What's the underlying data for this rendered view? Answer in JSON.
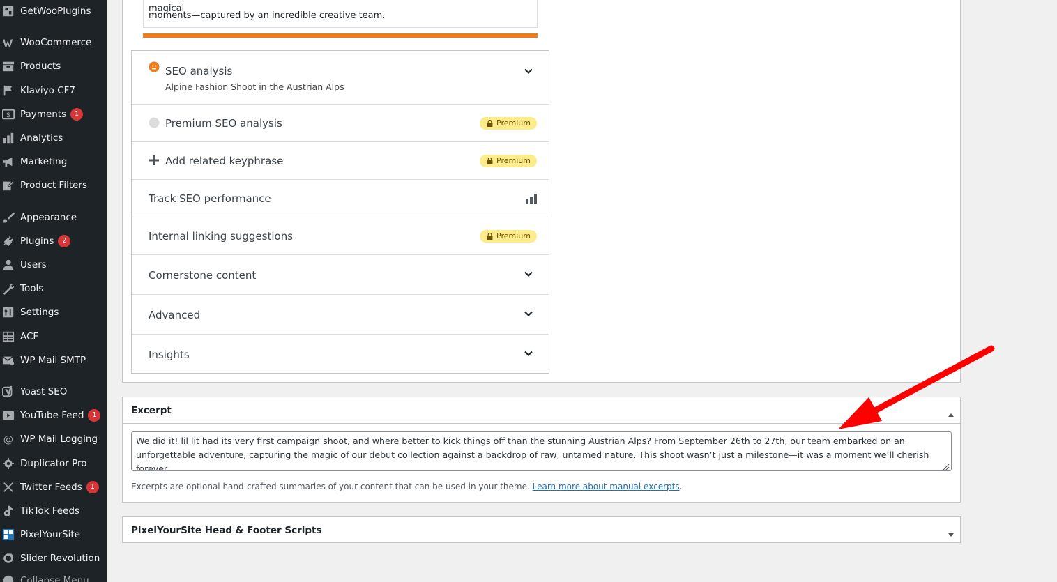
{
  "sidebar": {
    "items": [
      {
        "label": "GetWooPlugins",
        "icon": "plugin-grid-icon",
        "badge": ""
      },
      {
        "label": "WooCommerce",
        "icon": "woocommerce-icon",
        "badge": ""
      },
      {
        "label": "Products",
        "icon": "archive-icon",
        "badge": ""
      },
      {
        "label": "Klaviyo CF7",
        "icon": "flag-icon",
        "badge": ""
      },
      {
        "label": "Payments",
        "icon": "dollar-icon",
        "badge": "1"
      },
      {
        "label": "Analytics",
        "icon": "bar-chart-icon",
        "badge": ""
      },
      {
        "label": "Marketing",
        "icon": "megaphone-icon",
        "badge": ""
      },
      {
        "label": "Product Filters",
        "icon": "edit-icon",
        "badge": ""
      },
      {
        "label": "Appearance",
        "icon": "brush-icon",
        "badge": ""
      },
      {
        "label": "Plugins",
        "icon": "plug-icon",
        "badge": "2"
      },
      {
        "label": "Users",
        "icon": "user-icon",
        "badge": ""
      },
      {
        "label": "Tools",
        "icon": "wrench-icon",
        "badge": ""
      },
      {
        "label": "Settings",
        "icon": "settings-icon",
        "badge": ""
      },
      {
        "label": "ACF",
        "icon": "table-icon",
        "badge": ""
      },
      {
        "label": "WP Mail SMTP",
        "icon": "mail-icon",
        "badge": ""
      },
      {
        "label": "Yoast SEO",
        "icon": "yoast-icon",
        "badge": ""
      },
      {
        "label": "YouTube Feed",
        "icon": "youtube-icon",
        "badge": "1"
      },
      {
        "label": "WP Mail Logging",
        "icon": "at-icon",
        "badge": ""
      },
      {
        "label": "Duplicator Pro",
        "icon": "gear-icon",
        "badge": ""
      },
      {
        "label": "Twitter Feeds",
        "icon": "x-logo-icon",
        "badge": "1"
      },
      {
        "label": "TikTok Feeds",
        "icon": "tiktok-icon",
        "badge": ""
      },
      {
        "label": "PixelYourSite",
        "icon": "pixelyoursite-icon",
        "badge": ""
      },
      {
        "label": "Slider Revolution",
        "icon": "refresh-icon",
        "badge": ""
      },
      {
        "label": "Collapse Menu",
        "icon": "collapse-icon",
        "badge": ""
      }
    ]
  },
  "snippet": {
    "line1": "storms to stunning visuals, our first collection comes to life in raw, moody, and magical",
    "line2": "moments—captured by an incredible creative team."
  },
  "yoast": {
    "seo_analysis": {
      "title": "SEO analysis",
      "subtitle": "Alpine Fashion Shoot in the Austrian Alps"
    },
    "premium_seo": {
      "title": "Premium SEO analysis",
      "badge": "Premium"
    },
    "related_keyphrase": {
      "title": "Add related keyphrase",
      "badge": "Premium"
    },
    "track_seo": {
      "title": "Track SEO performance"
    },
    "internal_linking": {
      "title": "Internal linking suggestions",
      "badge": "Premium"
    },
    "cornerstone": {
      "title": "Cornerstone content"
    },
    "advanced": {
      "title": "Advanced"
    },
    "insights": {
      "title": "Insights"
    }
  },
  "excerpt": {
    "title": "Excerpt",
    "text": "We did it! lil lit had its very first campaign shoot, and where better to kick things off than the stunning Austrian Alps? From September 26th to 27th, our team embarked on an unforgettable adventure, capturing the magic of our debut collection against a backdrop of raw, untamed nature. This shoot wasn’t just a milestone—it was a moment we’ll cherish forever.",
    "help_text": "Excerpts are optional hand-crafted summaries of your content that can be used in your theme. ",
    "help_link": "Learn more about manual excerpts",
    "help_end": "."
  },
  "pixelyoursite": {
    "title": "PixelYourSite Head & Footer Scripts"
  },
  "colors": {
    "sidebar_bg": "#1d2327",
    "accent_orange": "#ee7c1b",
    "badge_red": "#d63638",
    "premium_yellow": "#fcec8b",
    "link_blue": "#2271b1",
    "annotation_red": "#ff0000"
  }
}
